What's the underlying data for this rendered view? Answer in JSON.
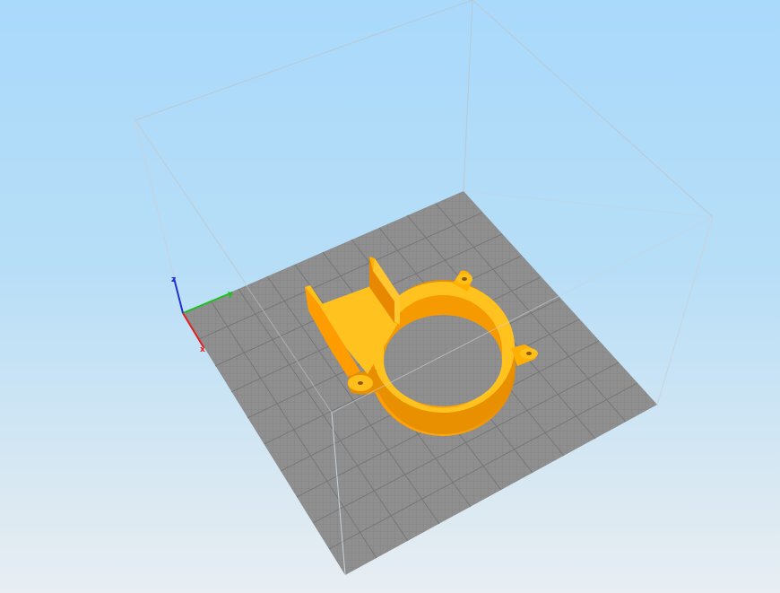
{
  "viewport": {
    "background_top": "#a9d9fb",
    "background_bottom": "#e8eef3",
    "bed_color": "#8e8e8e",
    "grid_color": "#7a7a7a",
    "model_color": "#ffa500",
    "model_top_color": "#ffbf1a",
    "model_shadow_color": "#e08a00"
  },
  "axes": {
    "x_label": "x",
    "y_label": "y",
    "z_label": "z",
    "x_color": "#e02020",
    "y_color": "#1fbf1f",
    "z_color": "#2030d0"
  }
}
